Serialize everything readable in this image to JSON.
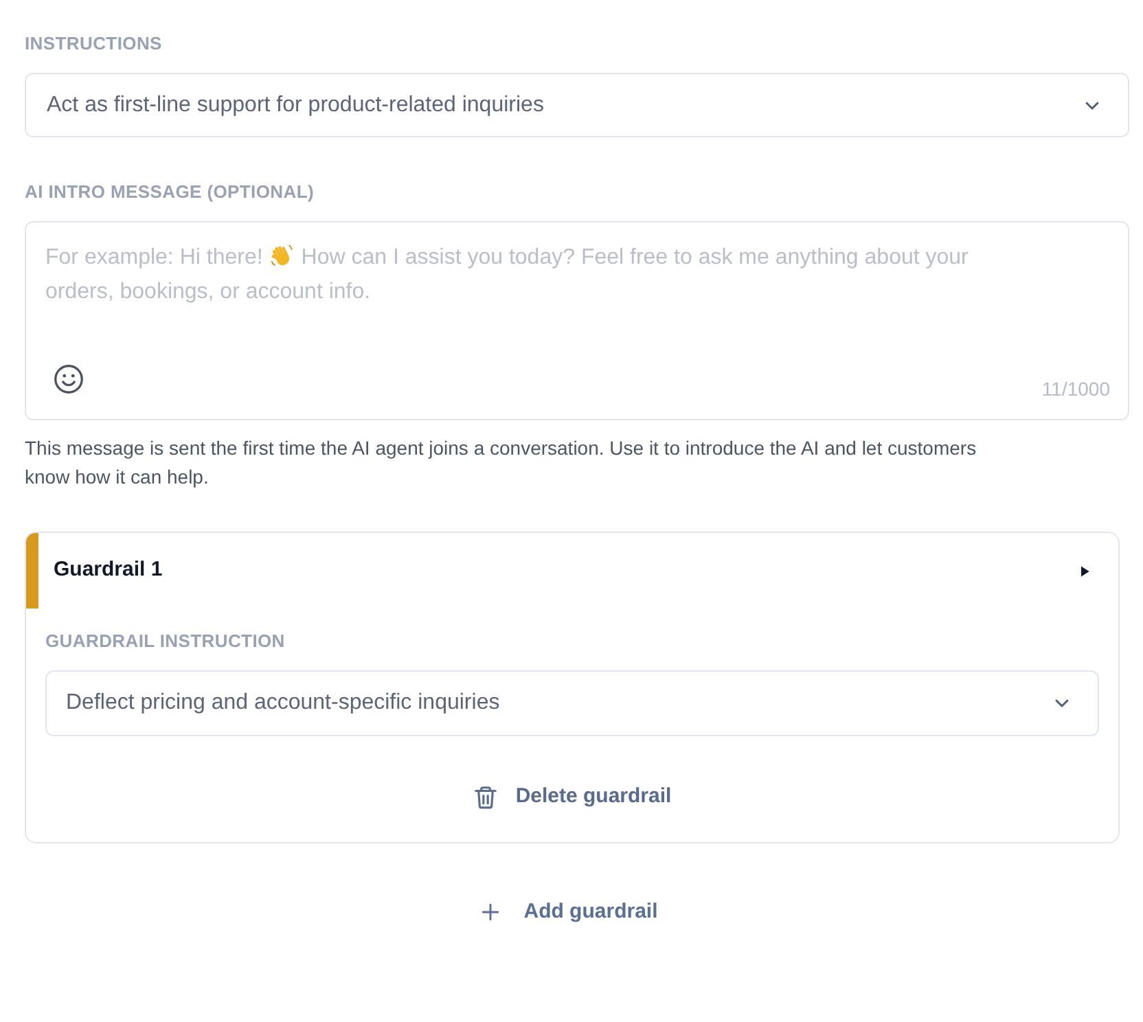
{
  "instructions": {
    "label": "INSTRUCTIONS",
    "value": "Act as first-line support for product-related inquiries"
  },
  "intro_message": {
    "label": "AI INTRO MESSAGE (OPTIONAL)",
    "placeholder": [
      "For example: Hi there!",
      "How can I assist you today? Feel free to ask me anything about your orders, bookings, or account info."
    ],
    "counter": "11/1000",
    "help": "This message is sent the first time the AI agent joins a conversation. Use it to introduce the AI and let customers know how it can help."
  },
  "guardrails": [
    {
      "title": "Guardrail 1",
      "color": "#d8991f",
      "field_label": "GUARDRAIL INSTRUCTION",
      "value": "Deflect pricing and account-specific inquiries",
      "delete_button": "Delete guardrail"
    }
  ],
  "add_button": "Add guardrail"
}
